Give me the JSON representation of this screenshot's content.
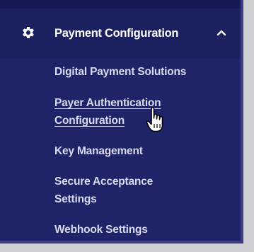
{
  "menu": {
    "header": {
      "label": "Payment Configuration",
      "icon": "gear-icon",
      "toggle_icon": "chevron-up-icon"
    },
    "items": [
      {
        "lines": [
          "Digital Payment Solutions"
        ]
      },
      {
        "lines": [
          "Payer Authentication",
          "Configuration"
        ],
        "state": "hover"
      },
      {
        "lines": [
          "Key Management"
        ]
      },
      {
        "lines": [
          "Secure Acceptance",
          "Settings"
        ]
      },
      {
        "lines": [
          "Webhook Settings"
        ]
      }
    ]
  },
  "colors": {
    "panel_background": "#1f2468",
    "header_background": "#1b205f",
    "text_primary": "#ffffff",
    "text_item": "#d7d9ee"
  }
}
